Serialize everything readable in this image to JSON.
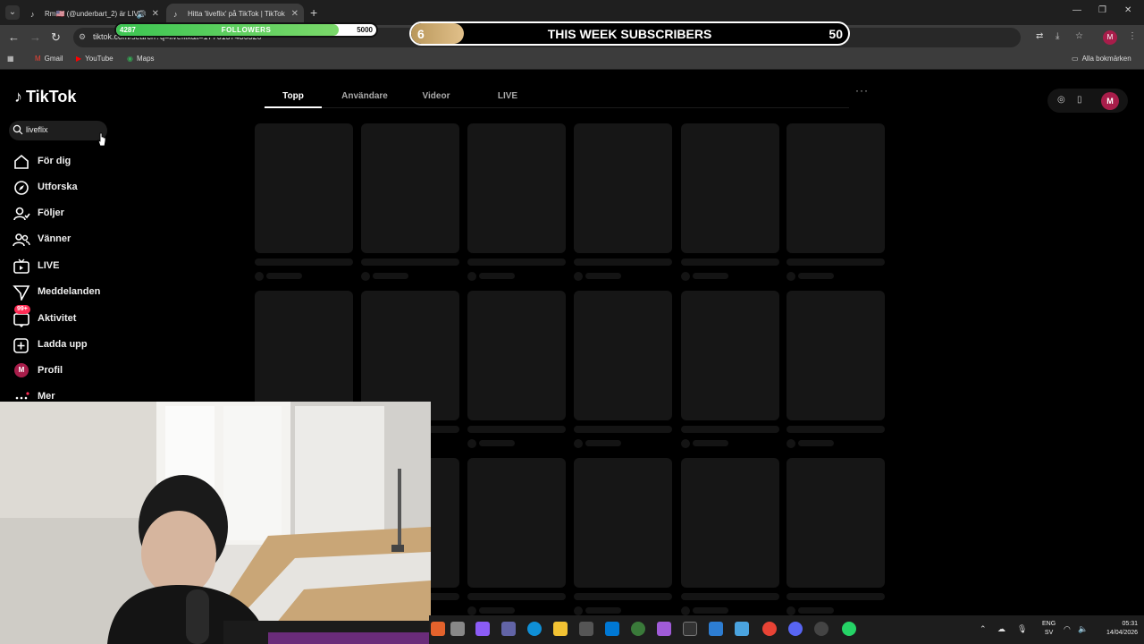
{
  "browser": {
    "tabs": [
      {
        "title": "Rm🇺🇸 (@underbart_2) är LIVE",
        "active": false
      },
      {
        "title": "Hitta 'liveflix' på TikTok | TikTok",
        "active": true
      }
    ],
    "url": "tiktok.com/search?q=liveflix&t=1776157436520",
    "bookmarks": [
      "Gmail",
      "YouTube",
      "Maps"
    ],
    "all_bookmarks": "Alla bokmärken",
    "profile_initial": "M"
  },
  "overlay": {
    "followers": {
      "current": "4287",
      "label": "FOLLOWERS",
      "goal": "5000",
      "progress": 0.857
    },
    "subscribers": {
      "current": "6",
      "label": "THIS WEEK SUBSCRIBERS",
      "goal": "50",
      "progress": 0.12
    }
  },
  "tiktok": {
    "logo": "TikTok",
    "search_value": "liveflix",
    "nav": [
      {
        "label": "För dig",
        "icon": "home-icon"
      },
      {
        "label": "Utforska",
        "icon": "compass-icon"
      },
      {
        "label": "Följer",
        "icon": "following-icon"
      },
      {
        "label": "Vänner",
        "icon": "friends-icon"
      },
      {
        "label": "LIVE",
        "icon": "live-icon"
      },
      {
        "label": "Meddelanden",
        "icon": "messages-icon"
      },
      {
        "label": "Aktivitet",
        "icon": "activity-icon",
        "badge": "99+"
      },
      {
        "label": "Ladda upp",
        "icon": "upload-icon"
      },
      {
        "label": "Profil",
        "icon": "profile-avatar"
      },
      {
        "label": "Mer",
        "icon": "more-icon"
      }
    ],
    "profile_initial": "M",
    "tabs": [
      "Topp",
      "Användare",
      "Videor",
      "LIVE"
    ],
    "active_tab": "Topp",
    "more": "···"
  },
  "taskbar": {
    "lang": [
      "ENG",
      "SV"
    ],
    "time": "05:31",
    "date": "14/04/2026"
  }
}
